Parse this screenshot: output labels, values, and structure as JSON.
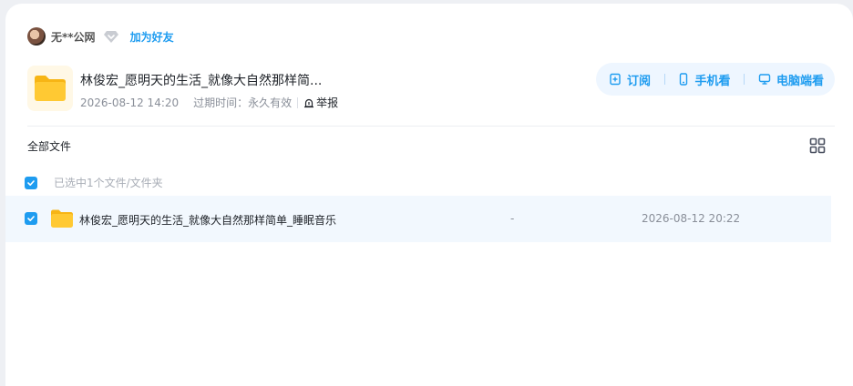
{
  "user": {
    "name": "无**公网",
    "add_friend": "加为好友"
  },
  "share": {
    "title": "林俊宏_愿明天的生活_就像大自然那样简...",
    "date": "2026-08-12 14:20",
    "expire_label": "过期时间：",
    "expire_value": "永久有效",
    "report": "举报"
  },
  "actions": {
    "subscribe": "订阅",
    "mobile": "手机看",
    "desktop": "电脑端看"
  },
  "breadcrumb": {
    "all_files": "全部文件"
  },
  "selection": {
    "text": "已选中1个文件/文件夹"
  },
  "files": [
    {
      "name": "林俊宏_愿明天的生活_就像大自然那样简单_睡眠音乐",
      "size": "-",
      "date": "2026-08-12 20:22",
      "checked": true
    }
  ],
  "colors": {
    "accent": "#1e9cf0",
    "row_selected": "#f2f8fe",
    "folder": "#ffc933"
  }
}
